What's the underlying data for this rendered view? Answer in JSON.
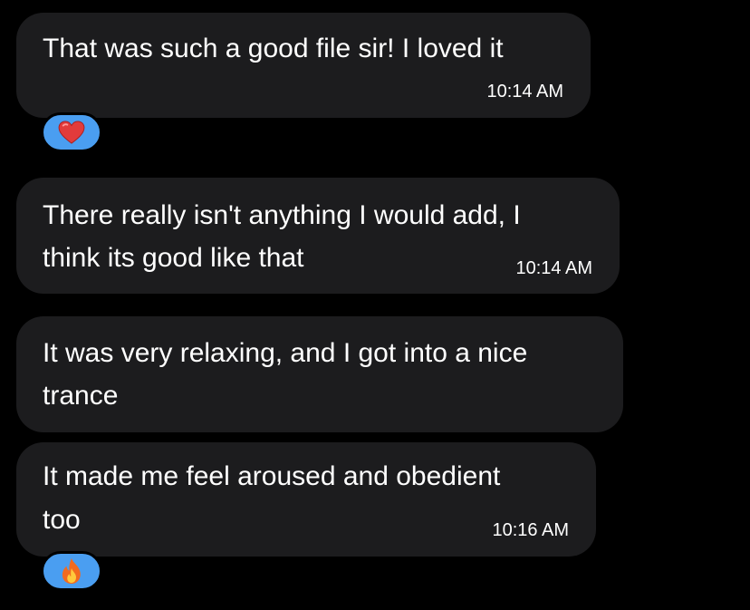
{
  "colors": {
    "background": "#000000",
    "bubble": "#1c1c1e",
    "reaction_badge": "#4a9ef1",
    "text": "#ffffff"
  },
  "messages": [
    {
      "lines": [
        "That was such a good file sir! I loved it"
      ],
      "time": "10:14 AM",
      "reaction": "heart-icon"
    },
    {
      "lines": [
        "There really isn't anything I would add, I",
        "think its good like that"
      ],
      "time": "10:14 AM"
    },
    {
      "lines": [
        "It was very relaxing, and I got into a nice",
        "trance"
      ],
      "time": ""
    },
    {
      "lines": [
        "It made me feel aroused and obedient",
        "too"
      ],
      "time": "10:16 AM",
      "reaction": "fire-icon"
    }
  ]
}
